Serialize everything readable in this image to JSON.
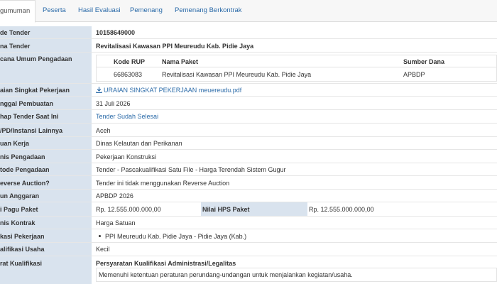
{
  "tabs": [
    {
      "label": "gumuman",
      "active": true
    },
    {
      "label": "Peserta"
    },
    {
      "label": "Hasil Evaluasi"
    },
    {
      "label": "Pemenang"
    },
    {
      "label": "Pemenang Berkontrak"
    }
  ],
  "fields": {
    "kode_tender": {
      "label": "de Tender",
      "value": "10158649000"
    },
    "nama_tender": {
      "label": "na Tender",
      "value": "Revitalisasi Kawasan PPI Meureudu Kab. Pidie Jaya"
    },
    "rencana": {
      "label": "cana Umum Pengadaan",
      "headers": [
        "Kode RUP",
        "Nama Paket",
        "Sumber Dana"
      ],
      "row": [
        "66863083",
        "Revitalisasi Kawasan PPI Meureudu Kab. Pidie Jaya",
        "APBDP"
      ]
    },
    "uraian": {
      "label": "aian Singkat Pekerjaan",
      "value": "URAIAN SINGKAT PEKERJAAN meuereudu.pdf"
    },
    "tanggal": {
      "label": "nggal Pembuatan",
      "value": "31 Juli 2026"
    },
    "tahap": {
      "label": "hap Tender Saat Ini",
      "value": "Tender Sudah Selesai"
    },
    "instansi": {
      "label": "/PD/Instansi Lainnya",
      "value": "Aceh"
    },
    "satuan_kerja": {
      "label": "uan Kerja",
      "value": "Dinas Kelautan dan Perikanan"
    },
    "jenis_pengadaan": {
      "label": "nis Pengadaan",
      "value": "Pekerjaan Konstruksi"
    },
    "metode": {
      "label": "tode Pengadaan",
      "value": "Tender - Pascakualifikasi Satu File - Harga Terendah Sistem Gugur"
    },
    "reverse": {
      "label": "everse Auction?",
      "value": "Tender ini tidak menggunakan Reverse Auction"
    },
    "tahun": {
      "label": "un Anggaran",
      "value": "APBDP 2026"
    },
    "pagu": {
      "label": "i Pagu Paket",
      "value": "Rp. 12.555.000.000,00",
      "hps_label": "Nilai HPS Paket",
      "hps_value": "Rp. 12.555.000.000,00"
    },
    "jenis_kontrak": {
      "label": "nis Kontrak",
      "value": "Harga Satuan"
    },
    "lokasi": {
      "label": "kasi Pekerjaan",
      "value": "PPI Meureudu Kab. Pidie Jaya - Pidie Jaya (Kab.)"
    },
    "kualifikasi": {
      "label": "alifikasi Usaha",
      "value": "Kecil"
    },
    "syarat": {
      "label": "rat Kualifikasi",
      "heading": "Persyaratan Kualifikasi Administrasi/Legalitas",
      "text": "Memenuhi ketentuan peraturan perundang-undangan untuk menjalankan kegiatan/usaha."
    }
  },
  "colors": {
    "label_bg": "#d9e3ee",
    "link": "#2a6aa8",
    "tab_bg": "#f7f7f7"
  }
}
